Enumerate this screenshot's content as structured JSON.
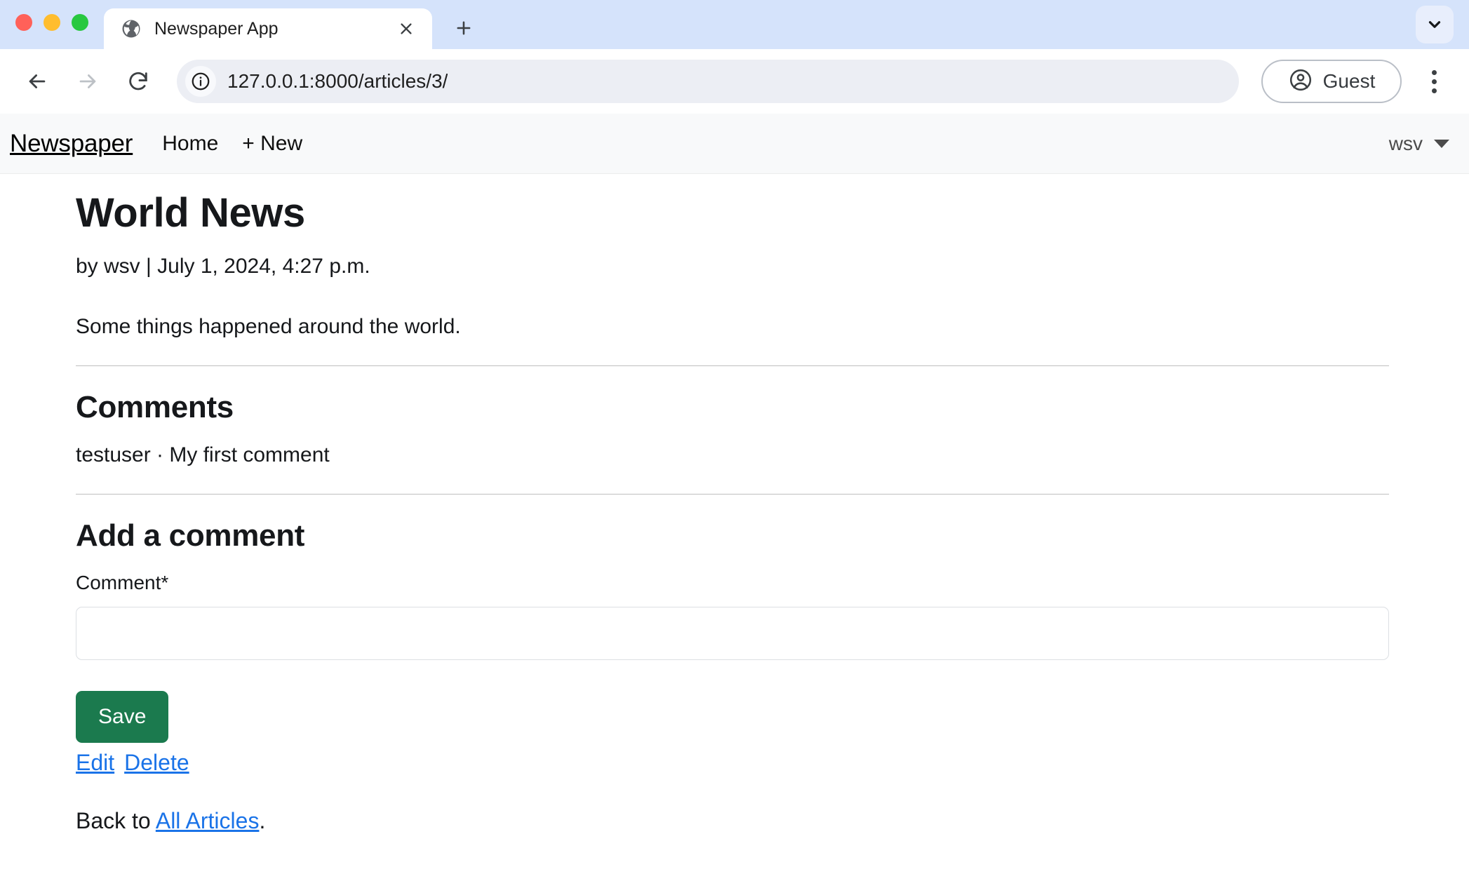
{
  "browser": {
    "window_controls": [
      "close",
      "minimize",
      "maximize"
    ],
    "tab": {
      "title": "Newspaper App",
      "favicon": "globe-icon",
      "close_label": "×"
    },
    "new_tab_label": "+",
    "tab_list_icon": "chevron-down-icon",
    "toolbar": {
      "back_icon": "back-arrow-icon",
      "forward_icon": "forward-arrow-icon",
      "reload_icon": "reload-icon",
      "site_info_icon": "info-circle-icon",
      "url": "127.0.0.1:8000/articles/3/",
      "url_placeholder": "Search Google or type a URL",
      "profile_label": "Guest",
      "profile_icon": "account-circle-icon",
      "menu_icon": "three-dot-menu-icon"
    }
  },
  "navbar": {
    "brand": "Newspaper",
    "links": [
      {
        "label": "Home"
      },
      {
        "label": "+ New"
      }
    ],
    "user": "wsv",
    "caret_icon": "caret-down-icon"
  },
  "article": {
    "title": "World News",
    "byline": "by wsv | July 1, 2024, 4:27 p.m.",
    "body": "Some things happened around the world."
  },
  "comments": {
    "heading": "Comments",
    "items": [
      {
        "author": "testuser",
        "separator": "·",
        "text": "My first comment",
        "line": "testuser · My first comment"
      }
    ]
  },
  "add_comment": {
    "heading": "Add a comment",
    "field_label": "Comment*",
    "field_value": "",
    "field_placeholder": "",
    "save_label": "Save"
  },
  "actions": {
    "edit_label": "Edit",
    "delete_label": "Delete"
  },
  "footer": {
    "back_prefix": "Back to ",
    "back_link": "All Articles",
    "back_suffix": "."
  },
  "colors": {
    "tabstrip": "#d5e3fb",
    "navbar_bg": "#f8f9fa",
    "save_green": "#1b7a4e",
    "link_blue": "#1a73e8",
    "text": "#16181b"
  }
}
